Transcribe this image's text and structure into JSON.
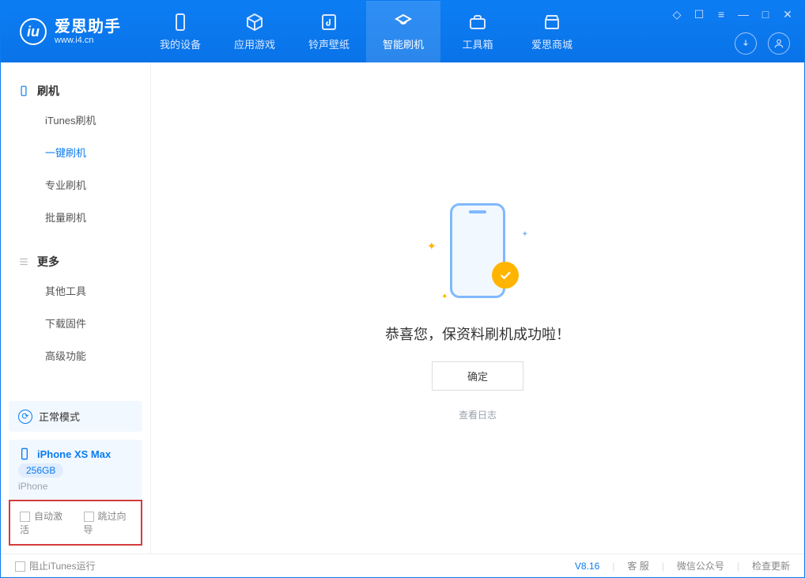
{
  "app": {
    "name": "爱思助手",
    "url": "www.i4.cn"
  },
  "nav": {
    "device": "我的设备",
    "apps": "应用游戏",
    "ring": "铃声壁纸",
    "flash": "智能刷机",
    "tools": "工具箱",
    "store": "爱思商城"
  },
  "sidebar": {
    "flash_head": "刷机",
    "items": {
      "itunes": "iTunes刷机",
      "oneclick": "一键刷机",
      "pro": "专业刷机",
      "batch": "批量刷机"
    },
    "more_head": "更多",
    "more": {
      "other": "其他工具",
      "firmware": "下载固件",
      "advanced": "高级功能"
    },
    "mode_label": "正常模式",
    "device_name": "iPhone XS Max",
    "device_storage": "256GB",
    "device_type": "iPhone",
    "auto_activate": "自动激活",
    "skip_wizard": "跳过向导"
  },
  "main": {
    "message": "恭喜您，保资料刷机成功啦！",
    "confirm": "确定",
    "view_log": "查看日志"
  },
  "footer": {
    "block_itunes": "阻止iTunes运行",
    "version": "V8.16",
    "cs": "客 服",
    "wechat": "微信公众号",
    "update": "检查更新"
  }
}
